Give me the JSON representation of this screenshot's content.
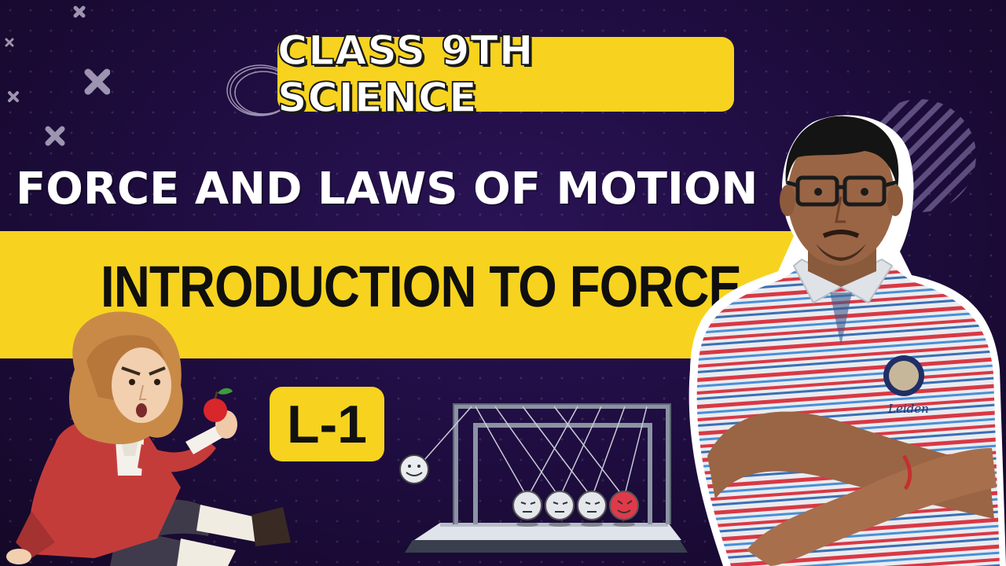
{
  "thumbnail": {
    "badge_text": "CLASS 9TH SCIENCE",
    "title": "FORCE AND LAWS OF MOTION",
    "subtitle": "INTRODUCTION TO FORCE",
    "lesson_label": "L-1",
    "shirt_logo_text": "Leiden"
  },
  "colors": {
    "background": "#1d0c3d",
    "accent_yellow": "#f7d31f",
    "title_text": "#ffffff",
    "subtitle_text": "#0f0f0f"
  },
  "illustrations": {
    "left": "newton-with-apple-cartoon",
    "center": "newtons-cradle",
    "right": "presenter-photo-arms-crossed"
  }
}
